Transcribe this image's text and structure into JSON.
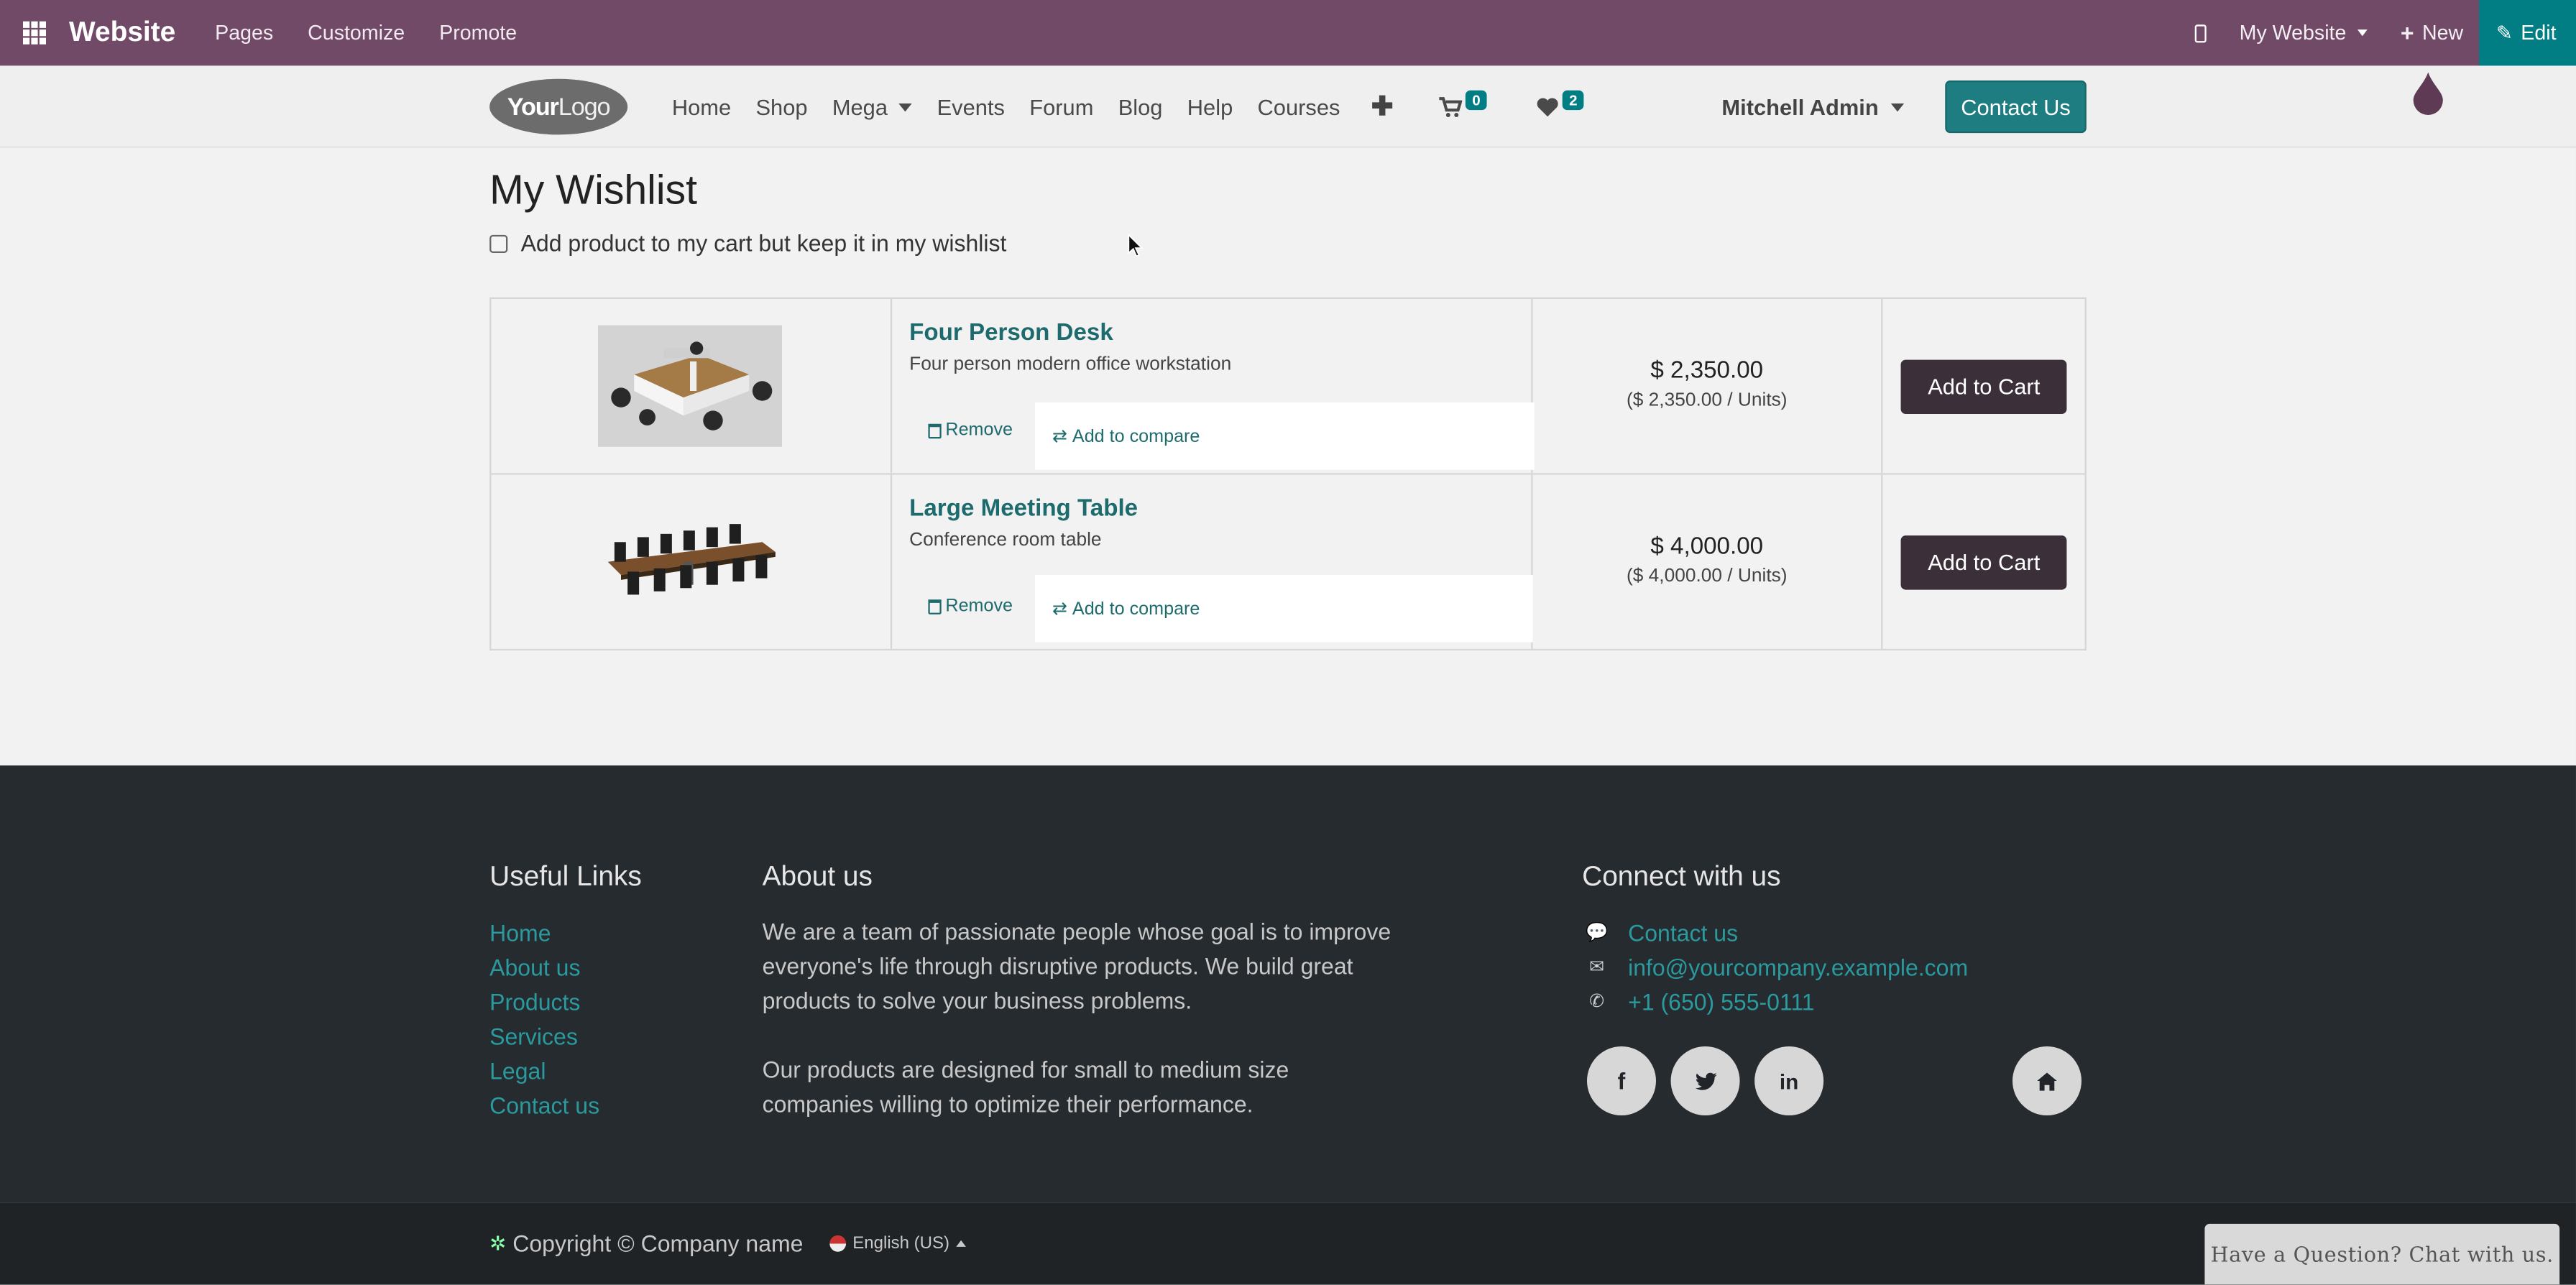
{
  "adminbar": {
    "brand": "Website",
    "menus": [
      "Pages",
      "Customize",
      "Promote"
    ],
    "website_selector": "My Website",
    "new_label": "New",
    "edit_label": "Edit"
  },
  "header": {
    "logo_text": "Your",
    "logo_text2": "Logo",
    "nav": [
      "Home",
      "Shop",
      "Mega",
      "Events",
      "Forum",
      "Blog",
      "Help",
      "Courses"
    ],
    "cart_count": "0",
    "wishlist_count": "2",
    "user": "Mitchell Admin",
    "contact_button": "Contact Us"
  },
  "page": {
    "title": "My Wishlist",
    "keep_in_wishlist_label": "Add product to my cart but keep it in my wishlist",
    "remove_label": "Remove",
    "compare_label": "Add to compare",
    "add_to_cart_label": "Add to Cart",
    "items": [
      {
        "name": "Four Person Desk",
        "description": "Four person modern office workstation",
        "price": "$ 2,350.00",
        "unit_price": "($ 2,350.00 / Units)"
      },
      {
        "name": "Large Meeting Table",
        "description": "Conference room table",
        "price": "$ 4,000.00",
        "unit_price": "($ 4,000.00 / Units)"
      }
    ]
  },
  "footer": {
    "useful_links_title": "Useful Links",
    "useful_links": [
      "Home",
      "About us",
      "Products",
      "Services",
      "Legal",
      "Contact us"
    ],
    "about_title": "About us",
    "about_p1": "We are a team of passionate people whose goal is to improve everyone's life through disruptive products. We build great products to solve your business problems.",
    "about_p2": "Our products are designed for small to medium size companies willing to optimize their performance.",
    "connect_title": "Connect with us",
    "contact_link": "Contact us",
    "email": "info@yourcompany.example.com",
    "phone": "+1 (650) 555-0111",
    "copyright": "Copyright © Company name",
    "language": "English (US)",
    "chat": "Have a Question? Chat with us."
  },
  "colors": {
    "admin_bar": "#704a66",
    "accent": "#017e84",
    "footer": "#262b2f"
  }
}
